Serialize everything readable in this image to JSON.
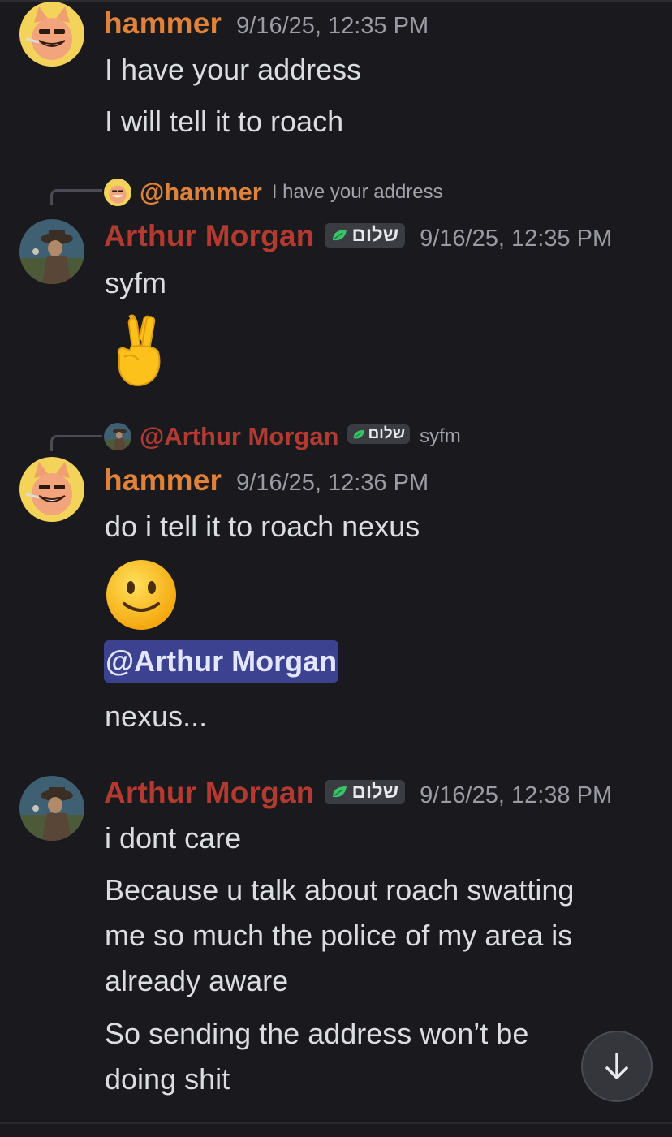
{
  "messages": [
    {
      "author": "hammer",
      "timestamp": "9/16/25, 12:35 PM",
      "lines": [
        "I have your address",
        "I will tell it to roach"
      ]
    },
    {
      "reply": {
        "author": "@hammer",
        "text": "I have your address"
      },
      "author": "Arthur Morgan",
      "tag": "שלום",
      "timestamp": "9/16/25, 12:35 PM",
      "lines": [
        "syfm"
      ],
      "emoji": "victory-hand"
    },
    {
      "reply": {
        "author": "@Arthur Morgan",
        "tag": "שלום",
        "text": "syfm"
      },
      "author": "hammer",
      "timestamp": "9/16/25, 12:36 PM",
      "lines": [
        "do i tell it to roach nexus"
      ],
      "emoji": "slightly-smiling-face",
      "mention": "@Arthur Morgan",
      "after_mention": "nexus..."
    },
    {
      "author": "Arthur Morgan",
      "tag": "שלום",
      "timestamp": "9/16/25, 12:38 PM",
      "lines": [
        "i dont care",
        "Because u talk about roach swatting",
        "me so much the police of my area is",
        "already aware",
        "So sending the address won’t be",
        "doing shit"
      ]
    }
  ],
  "colors": {
    "background": "#1a1a1e",
    "hammer_name": "#e0823a",
    "arthur_name": "#b33a30",
    "mention_bg": "#3c4290",
    "timestamp": "#9b9ca3"
  },
  "icons": {
    "scroll_button": "arrow-down-icon",
    "tag_icon": "leaf-icon"
  }
}
